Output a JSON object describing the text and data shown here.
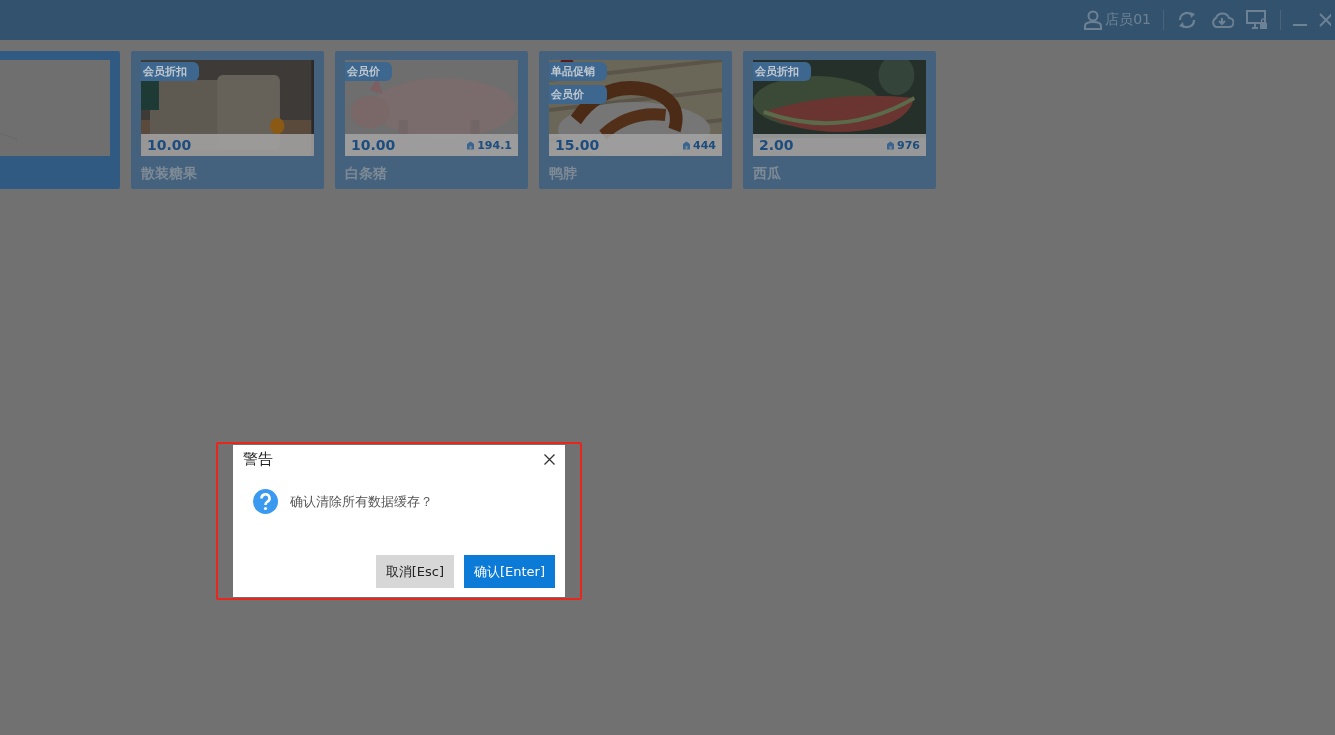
{
  "header": {
    "user": "店员01"
  },
  "products": [
    {
      "selected": true,
      "kind": "picture"
    },
    {
      "selected": false,
      "kind": "picture",
      "tags": [
        "会员折扣"
      ],
      "price": "10.00",
      "name": "散装糖果"
    },
    {
      "selected": false,
      "kind": "picture",
      "tags": [
        "会员价"
      ],
      "price": "10.00",
      "stock": "194.1",
      "name": "白条猪"
    },
    {
      "selected": false,
      "kind": "picture",
      "tags": [
        "单品促销",
        "会员价"
      ],
      "price": "15.00",
      "stock": "444",
      "name": "鸭脖"
    },
    {
      "selected": false,
      "kind": "picture",
      "tags": [
        "会员折扣"
      ],
      "price": "2.00",
      "stock": "976",
      "name": "西瓜"
    }
  ],
  "dialog": {
    "title": "警告",
    "message": "确认清除所有数据缓存？",
    "buttons": [
      {
        "label": "取消[Esc]",
        "kind": "secondary"
      },
      {
        "label": "确认[Enter]",
        "kind": "primary"
      }
    ]
  }
}
